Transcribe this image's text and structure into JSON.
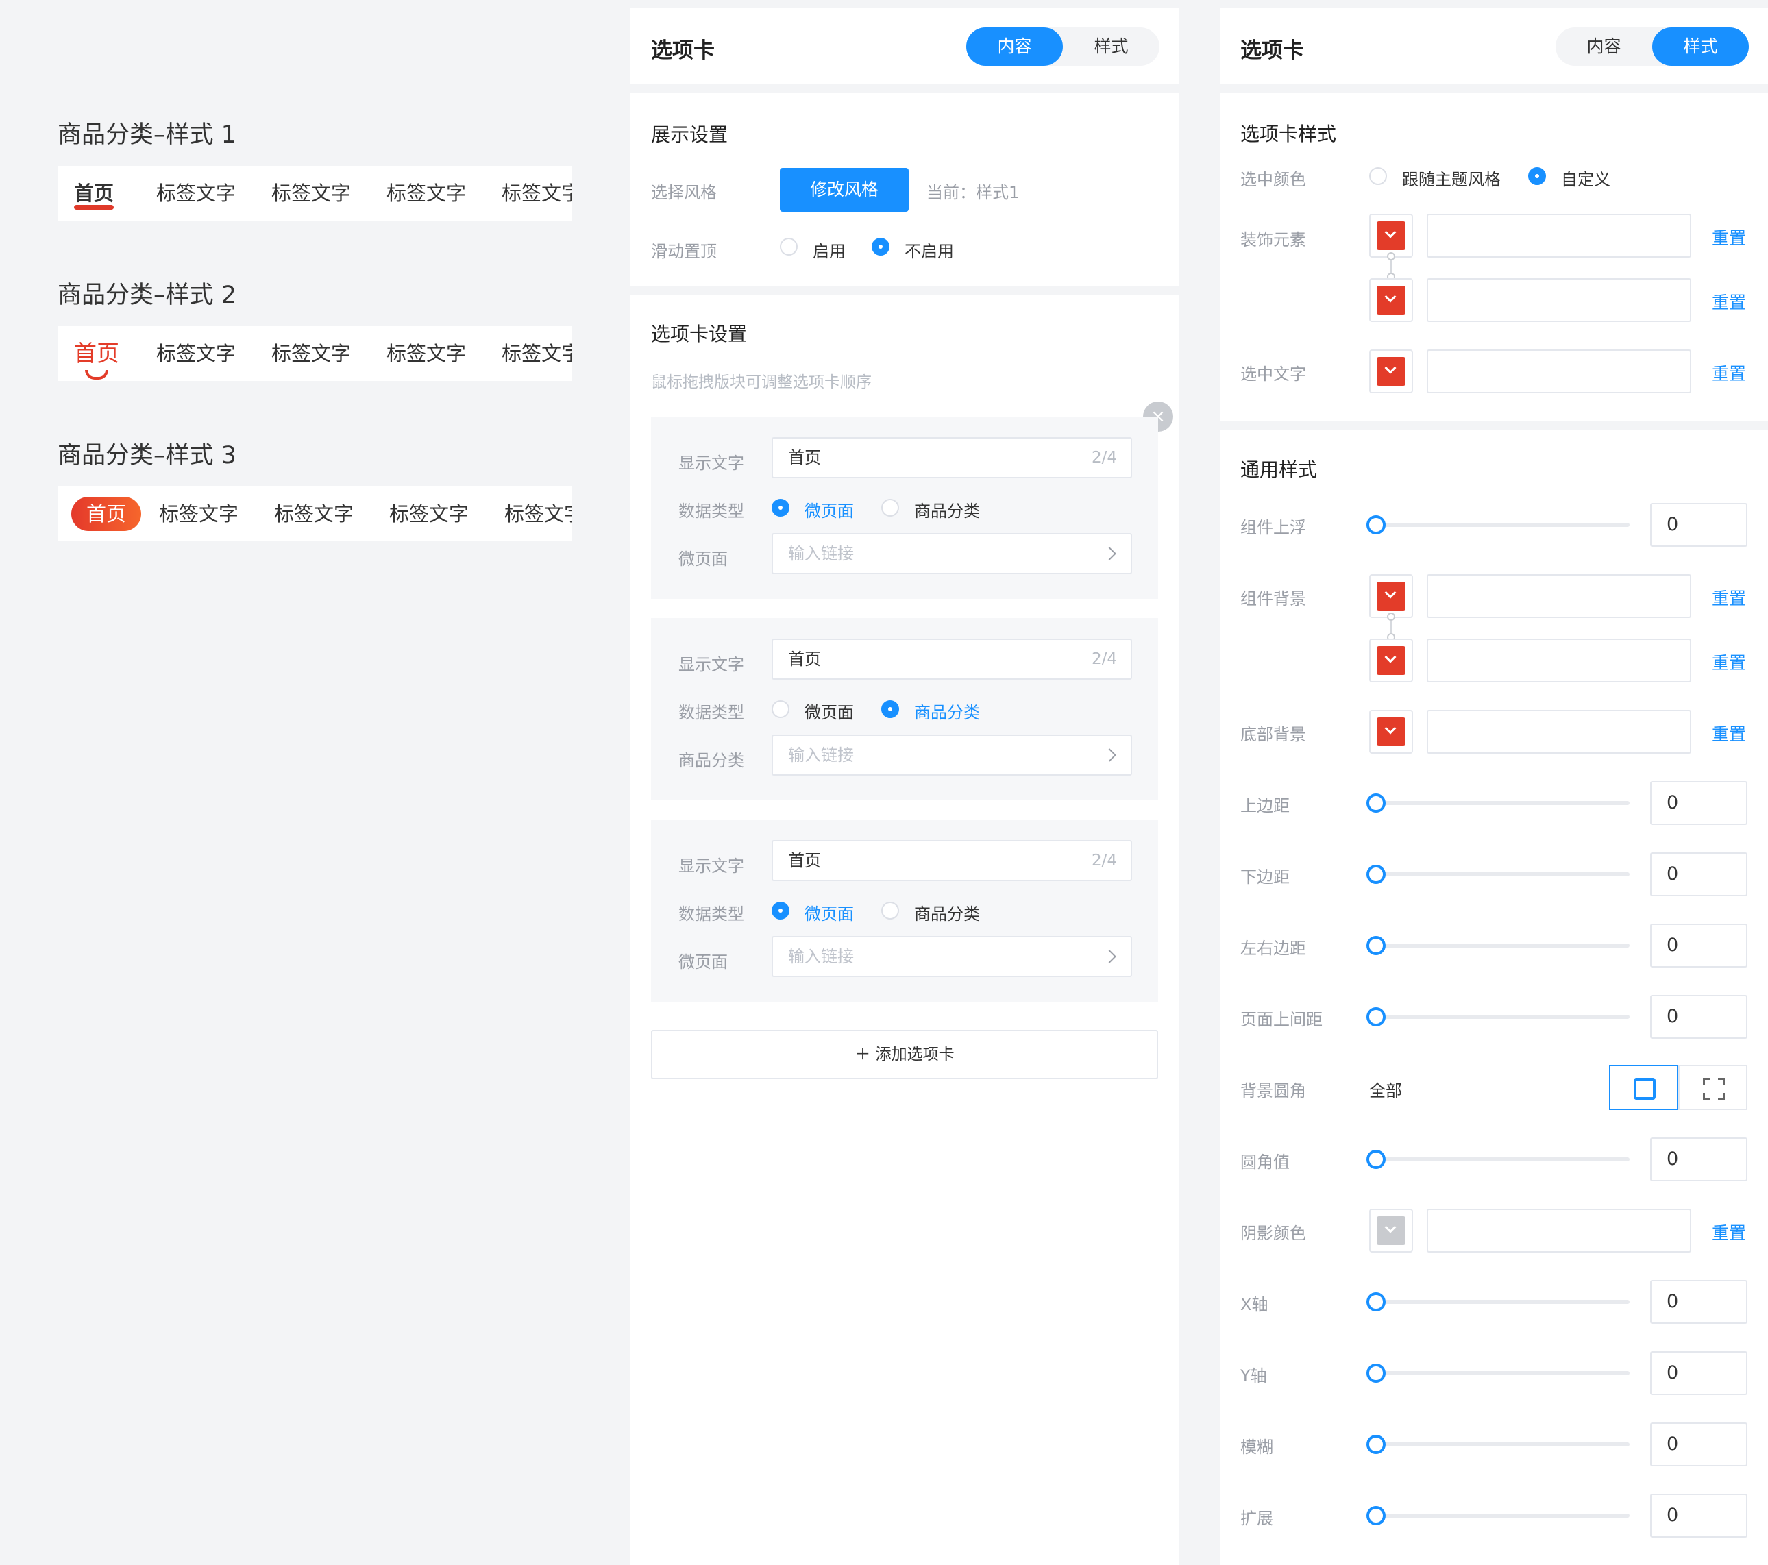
{
  "preview": {
    "styles": [
      {
        "title": "商品分类–样式 1",
        "tabs": [
          "首页",
          "标签文字",
          "标签文字",
          "标签文字",
          "标签文字"
        ]
      },
      {
        "title": "商品分类–样式 2",
        "tabs": [
          "首页",
          "标签文字",
          "标签文字",
          "标签文字",
          "标签文字"
        ]
      },
      {
        "title": "商品分类–样式 3",
        "tabs": [
          "首页",
          "标签文字",
          "标签文字",
          "标签文字",
          "标签文字"
        ]
      }
    ],
    "accent": "#e33c29"
  },
  "content_panel": {
    "title": "选项卡",
    "seg": {
      "content": "内容",
      "style": "样式",
      "active": "内容"
    },
    "display": {
      "title": "展示设置",
      "style_label": "选择风格",
      "modify_button": "修改风格",
      "current": "当前：样式1",
      "sticky_label": "滑动置顶",
      "sticky_on": "启用",
      "sticky_off": "不启用",
      "sticky_value": "不启用"
    },
    "tabs_settings": {
      "title": "选项卡设置",
      "hint": "鼠标拖拽版块可调整选项卡顺序",
      "close_icon": "×",
      "cards": [
        {
          "text_label": "显示文字",
          "text_value": "首页",
          "count": "2/4",
          "type_label": "数据类型",
          "opt1": "微页面",
          "opt2": "商品分类",
          "selected": "微页面",
          "link_label": "微页面",
          "link_placeholder": "输入链接"
        },
        {
          "text_label": "显示文字",
          "text_value": "首页",
          "count": "2/4",
          "type_label": "数据类型",
          "opt1": "微页面",
          "opt2": "商品分类",
          "selected": "商品分类",
          "link_label": "商品分类",
          "link_placeholder": "输入链接"
        },
        {
          "text_label": "显示文字",
          "text_value": "首页",
          "count": "2/4",
          "type_label": "数据类型",
          "opt1": "微页面",
          "opt2": "商品分类",
          "selected": "微页面",
          "link_label": "微页面",
          "link_placeholder": "输入链接"
        }
      ],
      "add_button": "＋ 添加选项卡"
    },
    "primary_color": "#1890ff"
  },
  "style_panel": {
    "title": "选项卡",
    "seg": {
      "content": "内容",
      "style": "样式",
      "active": "样式"
    },
    "tab_style": {
      "title": "选项卡样式",
      "selected_color_label": "选中颜色",
      "follow_theme": "跟随主题风格",
      "custom": "自定义",
      "selected_color_value": "自定义",
      "decor_label": "装饰元素",
      "selected_text_label": "选中文字",
      "reset": "重置"
    },
    "common": {
      "title": "通用样式",
      "float_label": "组件上浮",
      "float_value": "0",
      "bg_label": "组件背景",
      "bottom_bg_label": "底部背景",
      "top_margin_label": "上边距",
      "top_margin_value": "0",
      "bottom_margin_label": "下边距",
      "bottom_margin_value": "0",
      "lr_margin_label": "左右边距",
      "lr_margin_value": "0",
      "page_gap_label": "页面上间距",
      "page_gap_value": "0",
      "radius_label": "背景圆角",
      "radius_all": "全部",
      "radius_value_label": "圆角值",
      "radius_value": "0",
      "shadow_label": "阴影颜色",
      "x_label": "X轴",
      "x_value": "0",
      "y_label": "Y轴",
      "y_value": "0",
      "blur_label": "模糊",
      "blur_value": "0",
      "spread_label": "扩展",
      "spread_value": "0",
      "reset": "重置"
    },
    "swatch_color": "#e33c29",
    "shadow_swatch_color": "#c9cbcf"
  }
}
